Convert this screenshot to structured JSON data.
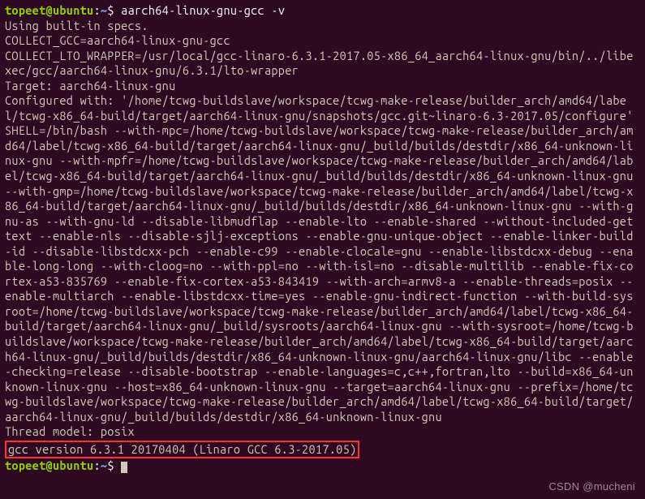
{
  "prompt": {
    "user_host": "topeet@ubuntu",
    "colon": ":",
    "path": "~",
    "dollar": "$"
  },
  "command": "aarch64-linux-gnu-gcc -v",
  "output": {
    "specs": "Using built-in specs.",
    "collect_gcc": "COLLECT_GCC=aarch64-linux-gnu-gcc",
    "lto_wrapper": "COLLECT_LTO_WRAPPER=/usr/local/gcc-linaro-6.3.1-2017.05-x86_64_aarch64-linux-gnu/bin/../libexec/gcc/aarch64-linux-gnu/6.3.1/lto-wrapper",
    "target": "Target: aarch64-linux-gnu",
    "configured": "Configured with: '/home/tcwg-buildslave/workspace/tcwg-make-release/builder_arch/amd64/label/tcwg-x86_64-build/target/aarch64-linux-gnu/snapshots/gcc.git~linaro-6.3-2017.05/configure' SHELL=/bin/bash --with-mpc=/home/tcwg-buildslave/workspace/tcwg-make-release/builder_arch/amd64/label/tcwg-x86_64-build/target/aarch64-linux-gnu/_build/builds/destdir/x86_64-unknown-linux-gnu --with-mpfr=/home/tcwg-buildslave/workspace/tcwg-make-release/builder_arch/amd64/label/tcwg-x86_64-build/target/aarch64-linux-gnu/_build/builds/destdir/x86_64-unknown-linux-gnu --with-gmp=/home/tcwg-buildslave/workspace/tcwg-make-release/builder_arch/amd64/label/tcwg-x86_64-build/target/aarch64-linux-gnu/_build/builds/destdir/x86_64-unknown-linux-gnu --with-gnu-as --with-gnu-ld --disable-libmudflap --enable-lto --enable-shared --without-included-gettext --enable-nls --disable-sjlj-exceptions --enable-gnu-unique-object --enable-linker-build-id --disable-libstdcxx-pch --enable-c99 --enable-clocale=gnu --enable-libstdcxx-debug --enable-long-long --with-cloog=no --with-ppl=no --with-isl=no --disable-multilib --enable-fix-cortex-a53-835769 --enable-fix-cortex-a53-843419 --with-arch=armv8-a --enable-threads=posix --enable-multiarch --enable-libstdcxx-time=yes --enable-gnu-indirect-function --with-build-sysroot=/home/tcwg-buildslave/workspace/tcwg-make-release/builder_arch/amd64/label/tcwg-x86_64-build/target/aarch64-linux-gnu/_build/sysroots/aarch64-linux-gnu --with-sysroot=/home/tcwg-buildslave/workspace/tcwg-make-release/builder_arch/amd64/label/tcwg-x86_64-build/target/aarch64-linux-gnu/_build/builds/destdir/x86_64-unknown-linux-gnu/aarch64-linux-gnu/libc --enable-checking=release --disable-bootstrap --enable-languages=c,c++,fortran,lto --build=x86_64-unknown-linux-gnu --host=x86_64-unknown-linux-gnu --target=aarch64-linux-gnu --prefix=/home/tcwg-buildslave/workspace/tcwg-make-release/builder_arch/amd64/label/tcwg-x86_64-build/target/aarch64-linux-gnu/_build/builds/destdir/x86_64-unknown-linux-gnu",
    "thread_model": "Thread model: posix",
    "version": "gcc version 6.3.1 20170404 (Linaro GCC 6.3-2017.05)"
  },
  "watermark": "CSDN @mucheni"
}
